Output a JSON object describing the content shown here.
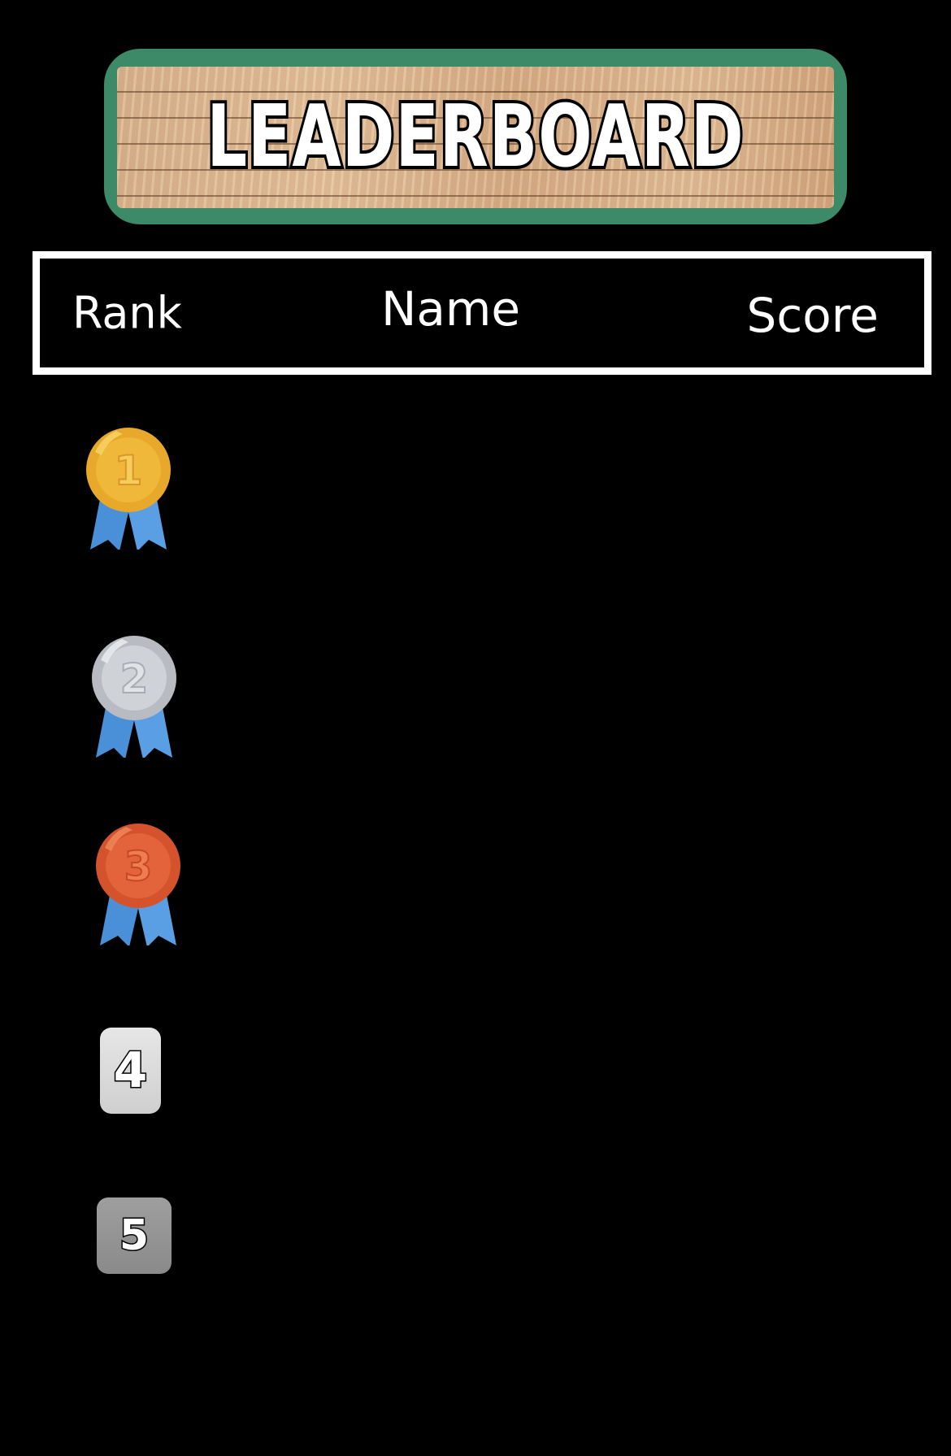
{
  "banner": {
    "title": "LEADERBOARD"
  },
  "header": {
    "rank_label": "Rank",
    "name_label": "Name",
    "score_label": "Score"
  },
  "ranks": [
    {
      "label": "1",
      "style": "gold-medal",
      "colors": {
        "coin": "#f0b83a",
        "rim": "#e8a82c",
        "ribbon": "#4a90d9"
      }
    },
    {
      "label": "2",
      "style": "silver-medal",
      "colors": {
        "coin": "#cfd2d6",
        "rim": "#b8bcc2",
        "ribbon": "#4a90d9"
      }
    },
    {
      "label": "3",
      "style": "bronze-medal",
      "colors": {
        "coin": "#e3633a",
        "rim": "#d4532c",
        "ribbon": "#4a90d9"
      }
    },
    {
      "label": "4",
      "style": "rank-box",
      "colors": {
        "box": "#dcdcdc"
      }
    },
    {
      "label": "5",
      "style": "rank-box",
      "colors": {
        "box": "#959595"
      }
    }
  ]
}
